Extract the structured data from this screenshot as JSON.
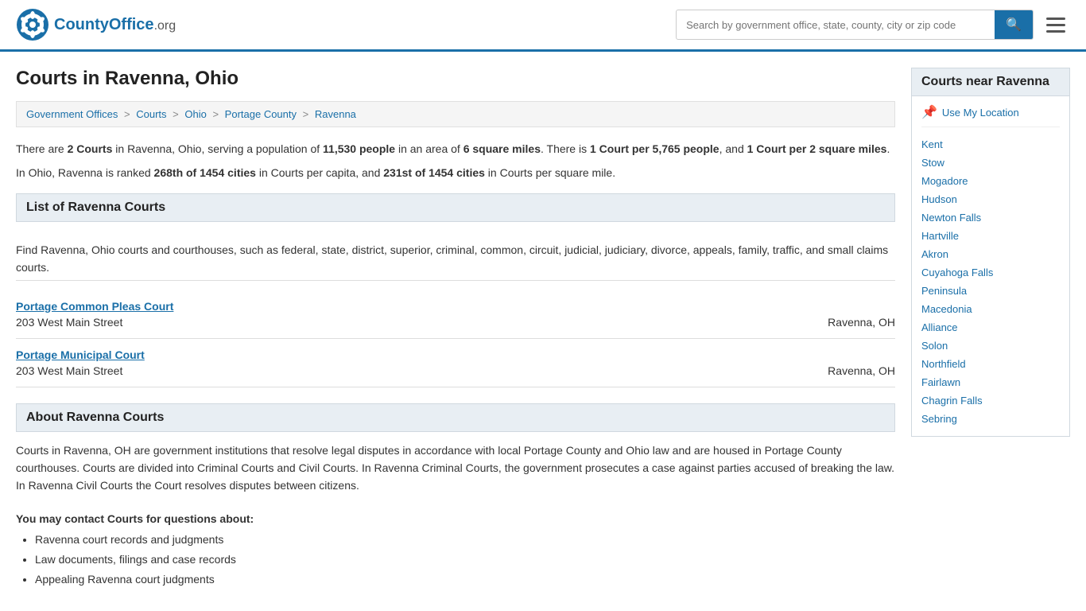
{
  "header": {
    "logo_text": "CountyOffice",
    "logo_suffix": ".org",
    "search_placeholder": "Search by government office, state, county, city or zip code",
    "search_button_label": "🔍"
  },
  "page": {
    "title": "Courts in Ravenna, Ohio",
    "breadcrumb": [
      {
        "label": "Government Offices",
        "href": "#"
      },
      {
        "label": "Courts",
        "href": "#"
      },
      {
        "label": "Ohio",
        "href": "#"
      },
      {
        "label": "Portage County",
        "href": "#"
      },
      {
        "label": "Ravenna",
        "href": "#"
      }
    ],
    "stats": {
      "intro": "There are ",
      "count": "2 Courts",
      "in_text": " in Ravenna, Ohio, serving a population of ",
      "population": "11,530 people",
      "area_text": " in an area of ",
      "area": "6 square miles",
      "trail": ". There is ",
      "per_capita": "1 Court per 5,765 people",
      "and_text": ", and ",
      "per_area": "1 Court per 2 square miles",
      "end": ".",
      "rank_intro": "In Ohio, Ravenna is ranked ",
      "rank_capita": "268th of 1454 cities",
      "rank_capita_text": " in Courts per capita, and ",
      "rank_area": "231st of 1454 cities",
      "rank_area_text": " in Courts per square mile."
    },
    "list_header": "List of Ravenna Courts",
    "list_description": "Find Ravenna, Ohio courts and courthouses, such as federal, state, district, superior, criminal, common, circuit, judicial, judiciary, divorce, appeals, family, traffic, and small claims courts.",
    "courts": [
      {
        "name": "Portage Common Pleas Court",
        "address": "203 West Main Street",
        "location": "Ravenna, OH",
        "href": "#"
      },
      {
        "name": "Portage Municipal Court",
        "address": "203 West Main Street",
        "location": "Ravenna, OH",
        "href": "#"
      }
    ],
    "about_header": "About Ravenna Courts",
    "about_text": "Courts in Ravenna, OH are government institutions that resolve legal disputes in accordance with local Portage County and Ohio law and are housed in Portage County courthouses. Courts are divided into Criminal Courts and Civil Courts. In Ravenna Criminal Courts, the government prosecutes a case against parties accused of breaking the law. In Ravenna Civil Courts the Court resolves disputes between citizens.",
    "contact_header": "You may contact Courts for questions about:",
    "contact_items": [
      "Ravenna court records and judgments",
      "Law documents, filings and case records",
      "Appealing Ravenna court judgments"
    ]
  },
  "sidebar": {
    "title": "Courts near Ravenna",
    "use_location_label": "Use My Location",
    "nearby_cities": [
      "Kent",
      "Stow",
      "Mogadore",
      "Hudson",
      "Newton Falls",
      "Hartville",
      "Akron",
      "Cuyahoga Falls",
      "Peninsula",
      "Macedonia",
      "Alliance",
      "Solon",
      "Northfield",
      "Fairlawn",
      "Chagrin Falls",
      "Sebring"
    ]
  }
}
